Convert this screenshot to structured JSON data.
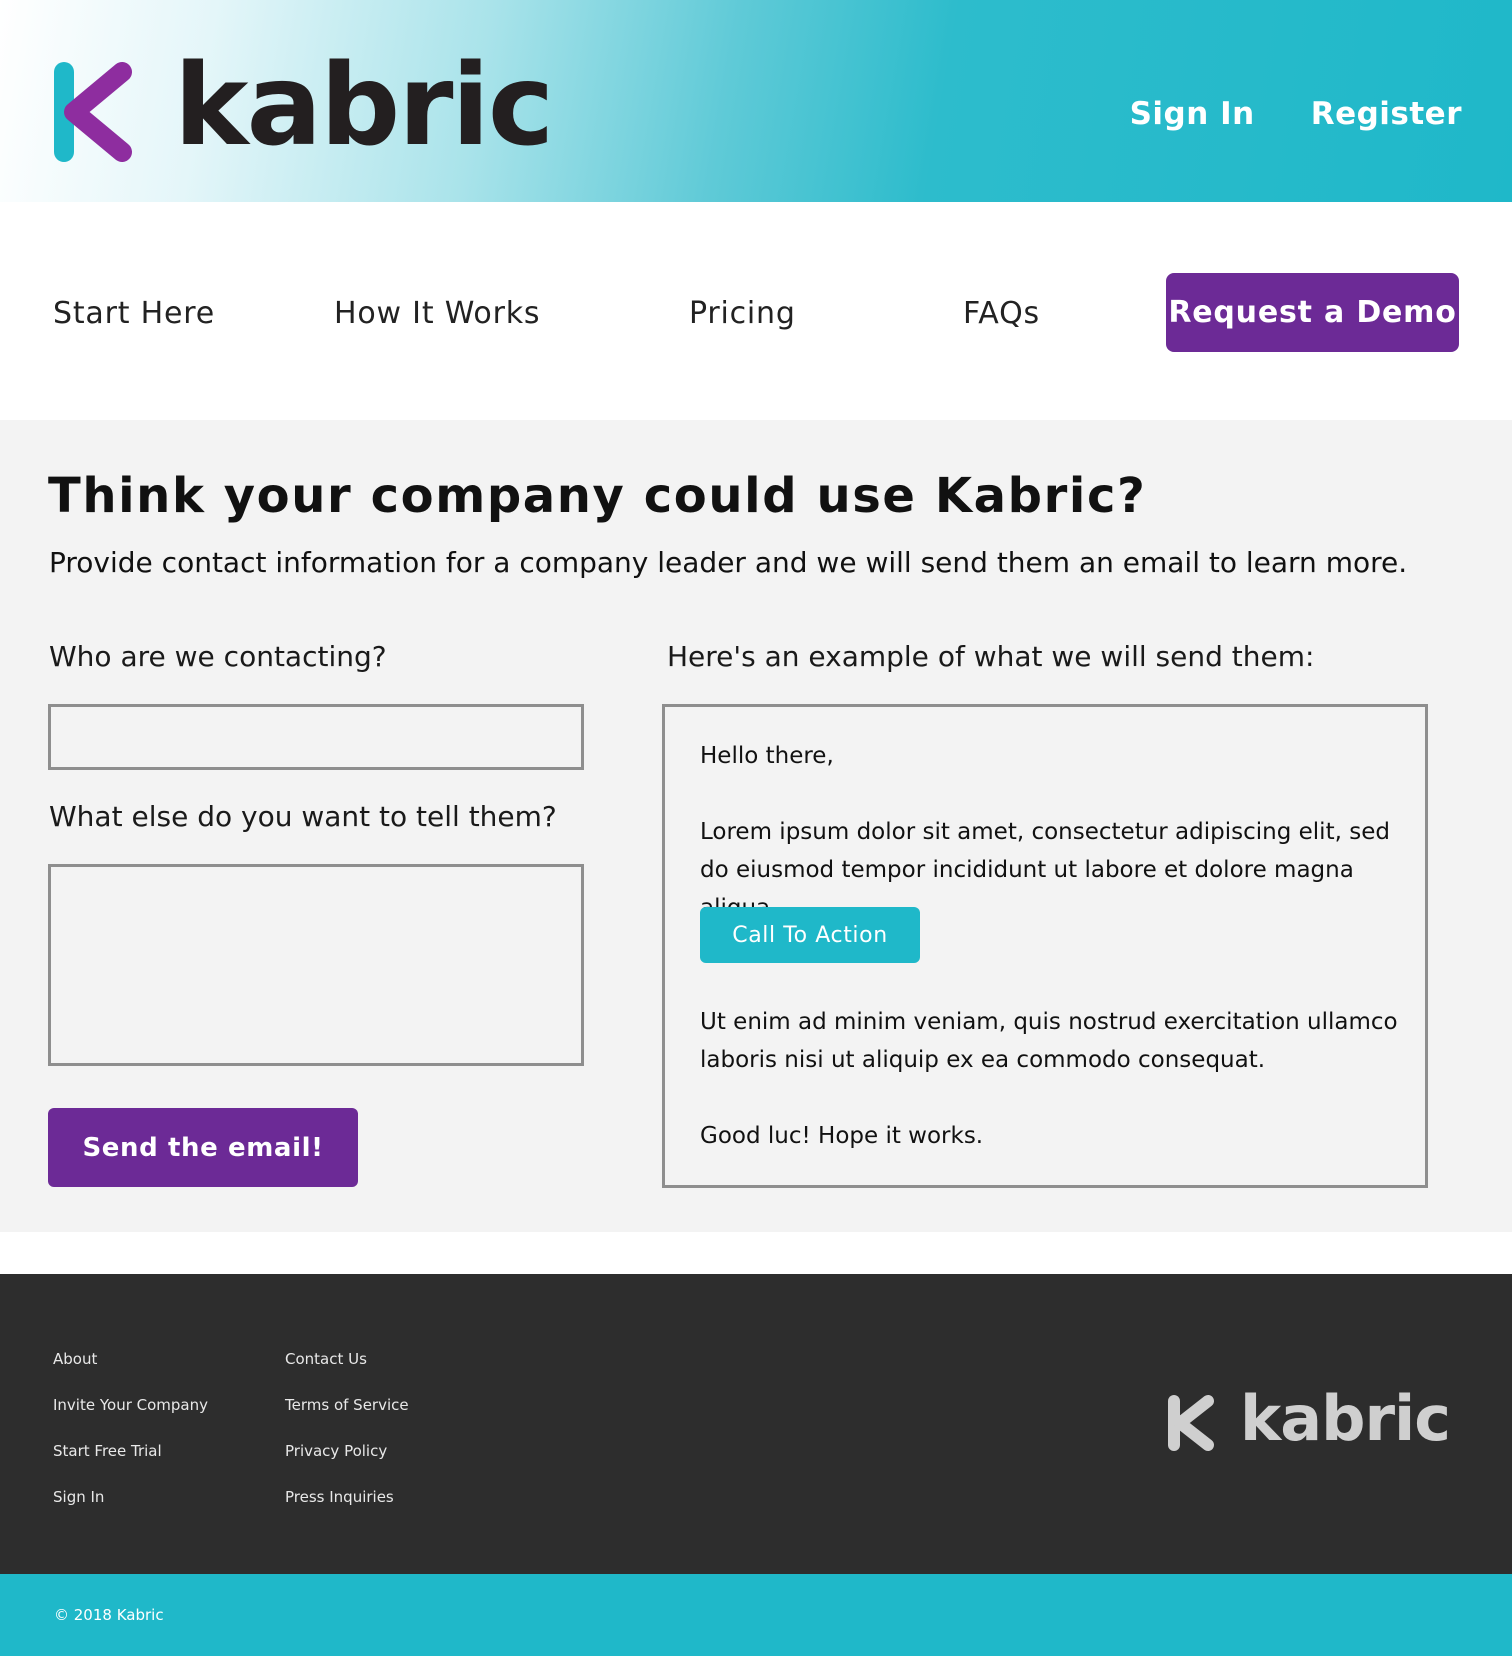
{
  "header": {
    "brand_name": "kabric",
    "sign_in": "Sign In",
    "register": "Register"
  },
  "nav": {
    "items": [
      "Start Here",
      "How It Works",
      "Pricing",
      "FAQs"
    ],
    "cta": "Request a Demo"
  },
  "main": {
    "headline": "Think your company could use Kabric?",
    "subhead": "Provide contact information for a company leader and we will send them an email to learn more.",
    "contact_label": "Who are we contacting?",
    "contact_value": "",
    "message_label": "What else do you want to tell them?",
    "message_value": "",
    "send_button": "Send the email!",
    "example_label": "Here's an example of what we will send them:",
    "example": {
      "greeting": "Hello there,",
      "para1": "Lorem ipsum dolor sit amet, consectetur adipiscing elit, sed do eiusmod tempor incididunt ut labore et dolore magna aliqua.",
      "cta": "Call To Action",
      "para2": "Ut enim ad minim veniam, quis nostrud exercitation ullamco laboris nisi ut aliquip ex ea commodo consequat.",
      "closing": "Good luc! Hope it works."
    }
  },
  "footer": {
    "col1": [
      "About",
      "Invite Your Company",
      "Start Free Trial",
      "Sign In"
    ],
    "col2": [
      "Contact Us",
      "Terms of Service",
      "Privacy Policy",
      "Press Inquiries"
    ],
    "brand_name": "kabric",
    "copyright": "© 2018 Kabric"
  },
  "colors": {
    "brand_purple": "#6c2a96",
    "brand_teal": "#1fb8c9",
    "footer_dark": "#2d2d2d",
    "main_bg": "#f3f3f3"
  },
  "icons": {
    "logo": "kabric-k-logo-icon",
    "footer_logo": "kabric-k-logo-icon"
  }
}
